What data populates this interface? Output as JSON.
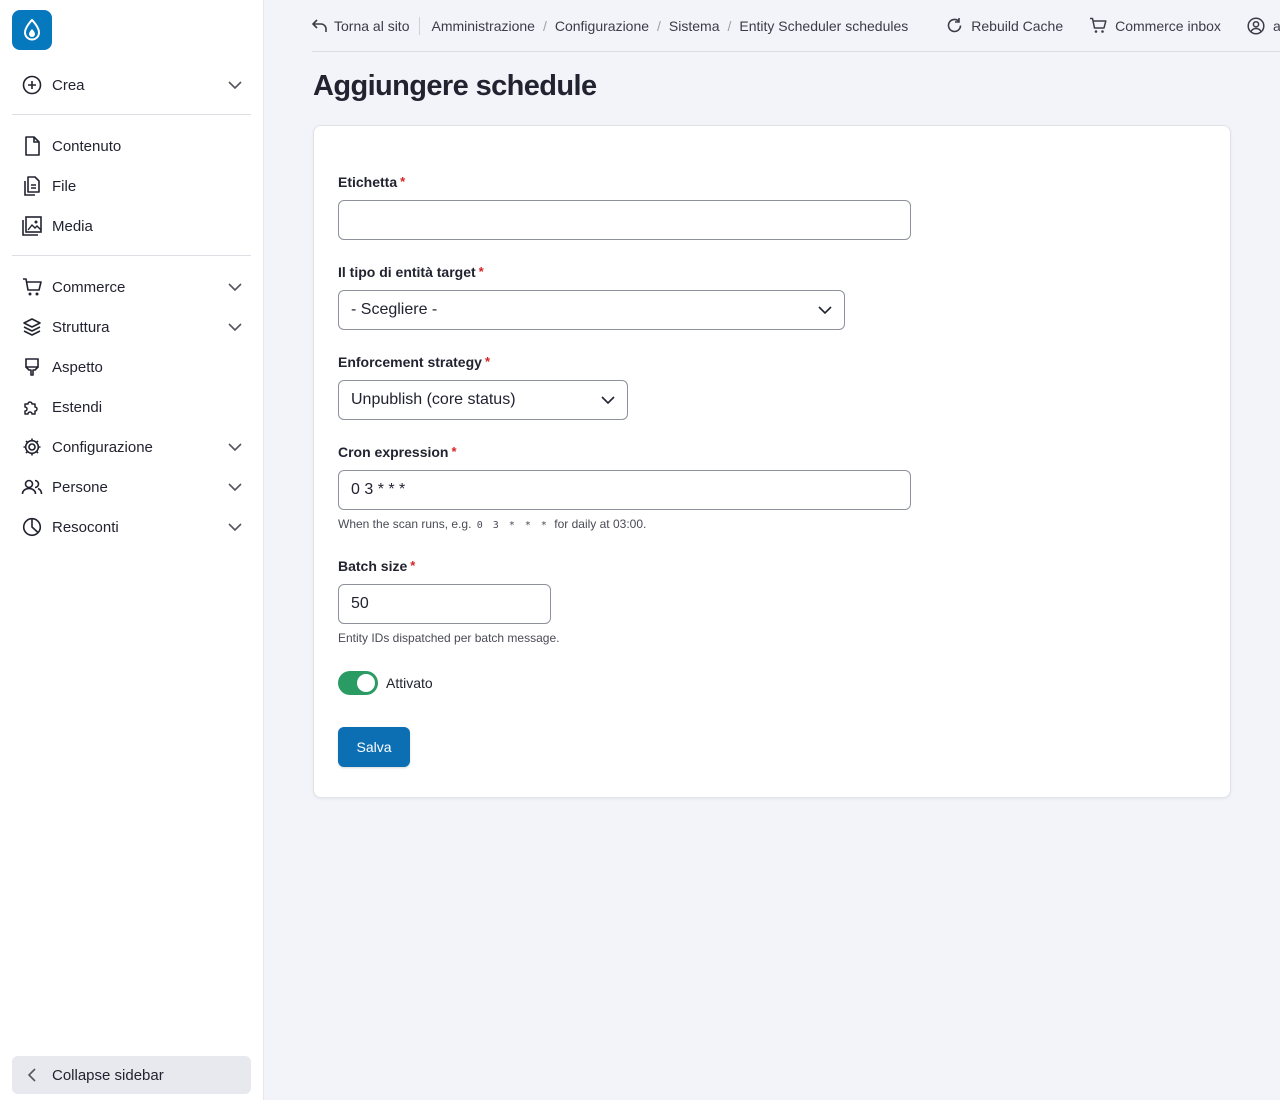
{
  "sidebar": {
    "create": "Crea",
    "items_top": [
      {
        "label": "Contenuto",
        "icon": "document-icon"
      },
      {
        "label": "File",
        "icon": "files-icon"
      },
      {
        "label": "Media",
        "icon": "media-icon"
      }
    ],
    "items_main": [
      {
        "label": "Commerce",
        "icon": "cart-icon",
        "expandable": true
      },
      {
        "label": "Struttura",
        "icon": "layers-icon",
        "expandable": true
      },
      {
        "label": "Aspetto",
        "icon": "brush-icon",
        "expandable": false
      },
      {
        "label": "Estendi",
        "icon": "puzzle-icon",
        "expandable": false
      },
      {
        "label": "Configurazione",
        "icon": "gear-icon",
        "expandable": true
      },
      {
        "label": "Persone",
        "icon": "people-icon",
        "expandable": true
      },
      {
        "label": "Resoconti",
        "icon": "piechart-icon",
        "expandable": true
      }
    ],
    "collapse": "Collapse sidebar"
  },
  "topbar": {
    "back": "Torna al sito",
    "breadcrumbs": [
      "Amministrazione",
      "Configurazione",
      "Sistema",
      "Entity Scheduler schedules"
    ],
    "rebuild": "Rebuild Cache",
    "inbox": "Commerce inbox",
    "user": "adm"
  },
  "page": {
    "title": "Aggiungere schedule"
  },
  "form": {
    "label_field": {
      "label": "Etichetta",
      "value": ""
    },
    "target": {
      "label": "Il tipo di entità target",
      "value": "- Scegliere -"
    },
    "strategy": {
      "label": "Enforcement strategy",
      "value": "Unpublish (core status)"
    },
    "cron": {
      "label": "Cron expression",
      "value": "0 3 * * *",
      "desc_before": "When the scan runs, e.g.",
      "desc_code": "0 3 * * *",
      "desc_after": "for daily at 03:00."
    },
    "batch": {
      "label": "Batch size",
      "value": "50",
      "desc": "Entity IDs dispatched per batch message."
    },
    "enabled": {
      "label": "Attivato",
      "on": true
    },
    "save": "Salva",
    "required_mark": "*"
  },
  "colors": {
    "accent": "#0678be",
    "toggle_on": "#2a9b63",
    "required": "#d72222"
  }
}
